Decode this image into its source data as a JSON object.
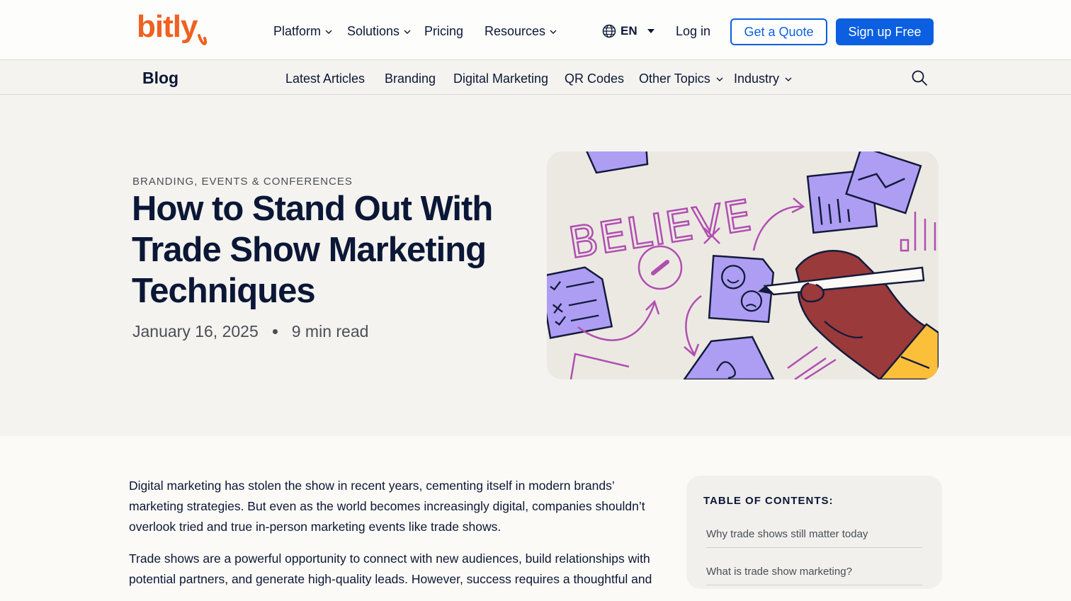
{
  "brand": {
    "logo_text": "bitly",
    "accent": "#ee6123",
    "primary": "#0b5fe0",
    "ink": "#0b1736"
  },
  "topnav": {
    "items": [
      {
        "label": "Platform",
        "has_dropdown": true
      },
      {
        "label": "Solutions",
        "has_dropdown": true
      },
      {
        "label": "Pricing",
        "has_dropdown": false
      },
      {
        "label": "Resources",
        "has_dropdown": true
      }
    ],
    "language": "EN",
    "login": "Log in",
    "quote": "Get a Quote",
    "signup": "Sign up Free"
  },
  "blognav": {
    "title": "Blog",
    "items": [
      {
        "label": "Latest Articles",
        "has_dropdown": false
      },
      {
        "label": "Branding",
        "has_dropdown": false
      },
      {
        "label": "Digital Marketing",
        "has_dropdown": false
      },
      {
        "label": "QR Codes",
        "has_dropdown": false
      },
      {
        "label": "Other Topics",
        "has_dropdown": true
      },
      {
        "label": "Industry",
        "has_dropdown": true
      }
    ]
  },
  "hero": {
    "category": "BRANDING, EVENTS & CONFERENCES",
    "title": "How to Stand Out With Trade Show Marketing Techniques",
    "date": "January 16, 2025",
    "read_time": "9 min read",
    "illustration_text": "BELIEVE"
  },
  "article": {
    "paragraphs": [
      "Digital marketing has stolen the show in recent years, cementing itself in modern brands’ marketing strategies. But even as the world becomes increasingly digital, companies shouldn’t overlook tried and true in-person marketing events like trade shows.",
      "Trade shows are a powerful opportunity to connect with new audiences, build relationships with potential partners, and generate high-quality leads. However, success requires a thoughtful and"
    ]
  },
  "toc": {
    "title": "TABLE OF CONTENTS:",
    "items": [
      "Why trade shows still matter today",
      "What is trade show marketing?"
    ]
  }
}
